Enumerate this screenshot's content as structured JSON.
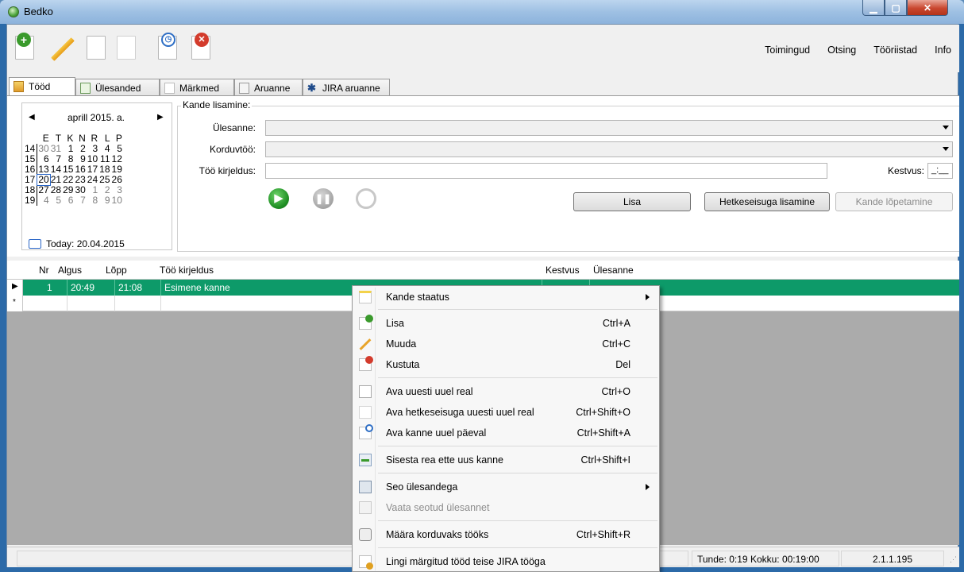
{
  "window": {
    "title": "Bedko"
  },
  "menu": [
    "Toimingud",
    "Otsing",
    "Tööriistad",
    "Info"
  ],
  "tabs": [
    "Tööd",
    "Ülesanded",
    "Märkmed",
    "Aruanne",
    "JIRA aruanne"
  ],
  "calendar": {
    "month": "aprill 2015. a.",
    "weekdays": [
      "E",
      "T",
      "K",
      "N",
      "R",
      "L",
      "P"
    ],
    "weeks": [
      {
        "wk": "14",
        "days": [
          "30",
          "31",
          "1",
          "2",
          "3",
          "4",
          "5"
        ]
      },
      {
        "wk": "15",
        "days": [
          "6",
          "7",
          "8",
          "9",
          "10",
          "11",
          "12"
        ]
      },
      {
        "wk": "16",
        "days": [
          "13",
          "14",
          "15",
          "16",
          "17",
          "18",
          "19"
        ]
      },
      {
        "wk": "17",
        "days": [
          "20",
          "21",
          "22",
          "23",
          "24",
          "25",
          "26"
        ]
      },
      {
        "wk": "18",
        "days": [
          "27",
          "28",
          "29",
          "30",
          "1",
          "2",
          "3"
        ]
      },
      {
        "wk": "19",
        "days": [
          "4",
          "5",
          "6",
          "7",
          "8",
          "9",
          "10"
        ]
      }
    ],
    "today": "Today: 20.04.2015"
  },
  "entry": {
    "group_title": "Kande lisamine:",
    "task_label": "Ülesanne:",
    "recurring_label": "Korduvtöö:",
    "desc_label": "Töö kirjeldus:",
    "duration_label": "Kestvus:",
    "duration_value": "_:__",
    "add_button": "Lisa",
    "add_now_button": "Hetkeseisuga lisamine",
    "finish_button": "Kande lõpetamine"
  },
  "grid": {
    "columns": [
      "Nr",
      "Algus",
      "Lõpp",
      "Töö kirjeldus",
      "Kestvus",
      "Ülesanne"
    ],
    "rows": [
      {
        "nr": "1",
        "start": "20:49",
        "end": "21:08",
        "desc": "Esimene kanne",
        "duration": "",
        "task": ""
      }
    ],
    "new_row_marker": "*"
  },
  "status": {
    "hours": "Tunde: 0:19 Kokku: 00:19:00",
    "version": "2.1.1.195"
  },
  "context_menu": [
    {
      "label": "Kande staatus",
      "shortcut": "",
      "submenu": true,
      "icon": "note-icon"
    },
    {
      "label": "Lisa",
      "shortcut": "Ctrl+A",
      "icon": "add-doc-icon"
    },
    {
      "label": "Muuda",
      "shortcut": "Ctrl+C",
      "icon": "pencil-icon"
    },
    {
      "label": "Kustuta",
      "shortcut": "Del",
      "icon": "delete-doc-icon"
    },
    {
      "label": "Ava uuesti uuel real",
      "shortcut": "Ctrl+O",
      "icon": "copy-doc-icon"
    },
    {
      "label": "Ava hetkeseisuga uuesti uuel real",
      "shortcut": "Ctrl+Shift+O",
      "icon": "copy-doc-icon"
    },
    {
      "label": "Ava kanne uuel päeval",
      "shortcut": "Ctrl+Shift+A",
      "icon": "clock-doc-icon"
    },
    {
      "label": "Sisesta rea ette uus kanne",
      "shortcut": "Ctrl+Shift+I",
      "icon": "insert-row-icon"
    },
    {
      "label": "Seo ülesandega",
      "shortcut": "",
      "submenu": true,
      "icon": "link-task-icon"
    },
    {
      "label": "Vaata seotud ülesannet",
      "shortcut": "",
      "disabled": true,
      "icon": "view-task-icon"
    },
    {
      "label": "Määra korduvaks tööks",
      "shortcut": "Ctrl+Shift+R",
      "icon": "recurring-icon"
    },
    {
      "label": "Lingi märgitud tööd teise JIRA tööga",
      "shortcut": "",
      "icon": "jira-link-icon"
    }
  ]
}
